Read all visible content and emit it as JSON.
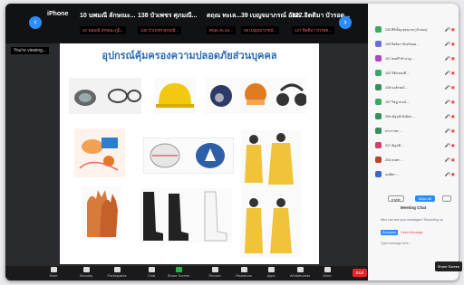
{
  "tiles": [
    {
      "name": "iPhone",
      "sub": ""
    },
    {
      "name": "10 นพมณี ลักษณะ...",
      "sub": "10 นพมณี ลักษณะภูมิ..."
    },
    {
      "name": "138 บัวเพชร ศุภมณี...",
      "sub": "138 บัวเพชร ศุภมณี..."
    },
    {
      "name": "ตฤณ ทะเล...",
      "sub": "ตฤณ ทะเลเ..."
    },
    {
      "name": "39 เบญจมาภรณ์ อัตถ...",
      "sub": "39 เบญจมาภรณ์..."
    },
    {
      "name": "127 จิตติมา บัวรอด...",
      "sub": "127 จิตติมา บัวรอด..."
    }
  ],
  "share": {
    "label": "You're viewing..."
  },
  "slide": {
    "title": "อุปกรณ์คุ้มครองความปลอดภัยส่วนบุคคล"
  },
  "toolbar": {
    "items": [
      "Mute",
      "Security",
      "Participants",
      "Chat",
      "Share Screen",
      "Record",
      "Reactions",
      "Apps",
      "Whiteboards",
      "More"
    ],
    "participants_count": "21",
    "end_label": "End"
  },
  "participants": [
    {
      "name": "133 ศิริเพ็ญ สุขสุเวช (เจ้าของ)",
      "color": "#37a865"
    },
    {
      "name": "103 ปิยธิดา จันทร์ลอย ...",
      "color": "#6a6fd8"
    },
    {
      "name": "107 สมศรี ชำนาญ ...",
      "color": "#b244c7"
    },
    {
      "name": "103 วิชัย ทองดี ...",
      "color": "#37a865"
    },
    {
      "name": "128 นงลักษณ์ ...",
      "color": "#3a8d5d"
    },
    {
      "name": "107 รัชฎาภรณ์ ...",
      "color": "#37a865"
    },
    {
      "name": "209 ณัฐวุฒิ มิ่งมิตร ...",
      "color": "#3a8d5d"
    },
    {
      "name": "ประภาพร ...",
      "color": "#3a8d5d"
    },
    {
      "name": "217 อัญชลี ...",
      "color": "#d43e6a"
    },
    {
      "name": "204 ธนพร ...",
      "color": "#b7442d"
    },
    {
      "name": "อนุชิตา ...",
      "color": "#3a66c9"
    }
  ],
  "panel": {
    "invite_label": "Invite",
    "mute_all_label": "Mute All",
    "more_label": "..."
  },
  "chat": {
    "title": "Meeting Chat",
    "placeholder_msg": "Who can see your messages? Recording on",
    "to_label": "Everyone",
    "dm_note": "Direct Message",
    "input_placeholder": "Type message here..."
  },
  "share_screen_label": "Share Screen"
}
